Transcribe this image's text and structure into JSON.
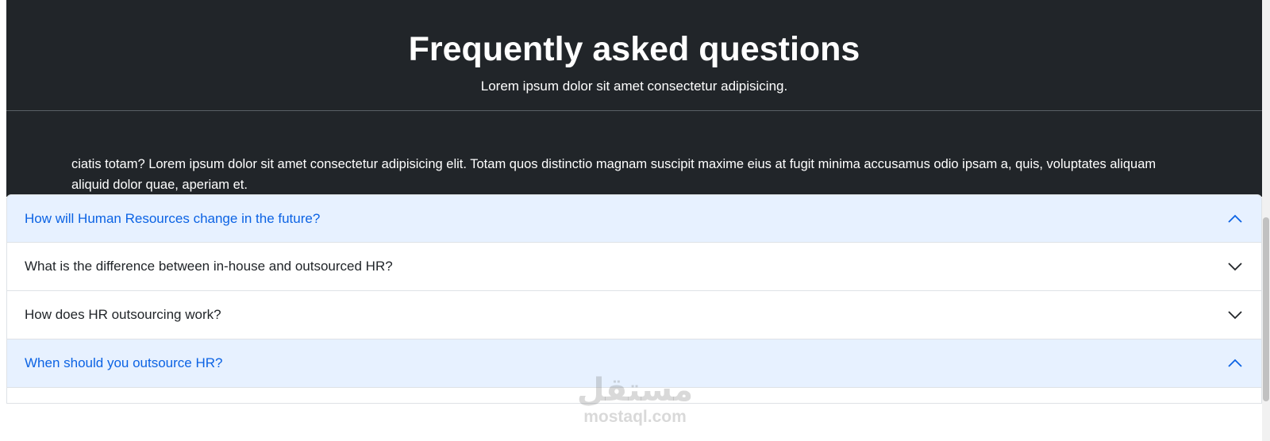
{
  "hero": {
    "title": "Frequently asked questions",
    "subtitle": "Lorem ipsum dolor sit amet consectetur adipisicing."
  },
  "body_text": "ciatis totam? Lorem ipsum dolor sit amet consectetur adipisicing elit. Totam quos distinctio magnam suscipit maxime eius at fugit minima accusamus odio ipsam a, quis, voluptates aliquam aliquid dolor quae, aperiam et.",
  "faq": {
    "items": [
      {
        "question": "How will Human Resources change in the future?",
        "expanded": true
      },
      {
        "question": "What is the difference between in-house and outsourced HR?",
        "expanded": false
      },
      {
        "question": "How does HR outsourcing work?",
        "expanded": false
      },
      {
        "question": "When should you outsource HR?",
        "expanded": true
      }
    ]
  },
  "watermark": {
    "logo_text": "مستقل",
    "url": "mostaql.com"
  },
  "colors": {
    "dark_background": "#212529",
    "expanded_background": "#e7f1ff",
    "expanded_text": "#0c63e4",
    "collapsed_text": "#212529"
  }
}
